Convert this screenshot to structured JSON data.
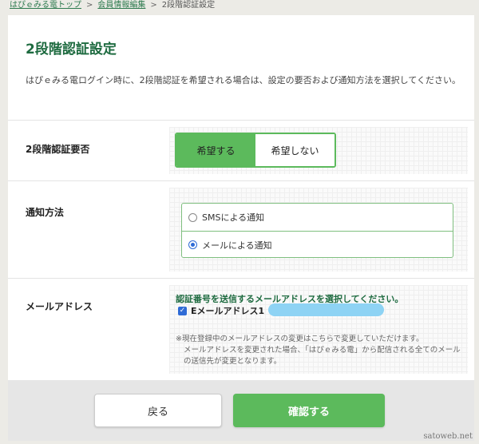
{
  "breadcrumb": {
    "items": [
      "はぴｅみる電トップ",
      "会員情報編集"
    ],
    "current": "2段階認証設定",
    "separator": ">"
  },
  "page": {
    "title": "2段階認証設定",
    "description": "はぴｅみる電ログイン時に、2段階認証を希望される場合は、設定の要否および通知方法を選択してください。"
  },
  "two_step": {
    "label": "2段階認証要否",
    "options": [
      "希望する",
      "希望しない"
    ],
    "selected": "希望する"
  },
  "notify": {
    "label": "通知方法",
    "options": [
      "SMSによる通知",
      "メールによる通知"
    ],
    "selected": "メールによる通知"
  },
  "mail": {
    "label": "メールアドレス",
    "instruction": "認証番号を送信するメールアドレスを選択してください。",
    "checkbox_label": "Eメールアドレス1",
    "checked": true,
    "note_1": "※現在登録中のメールアドレスの変更はこちらで変更していただけます。",
    "note_2": "メールアドレスを変更された場合、「はぴｅみる電」から配信される全てのメールの送信先が変更となります。"
  },
  "buttons": {
    "back": "戻る",
    "confirm": "確認する"
  },
  "watermark": "satoweb.net",
  "colors": {
    "accent": "#5cba5c",
    "title": "#1e6b40",
    "radio_selected": "#2f6bd6"
  }
}
